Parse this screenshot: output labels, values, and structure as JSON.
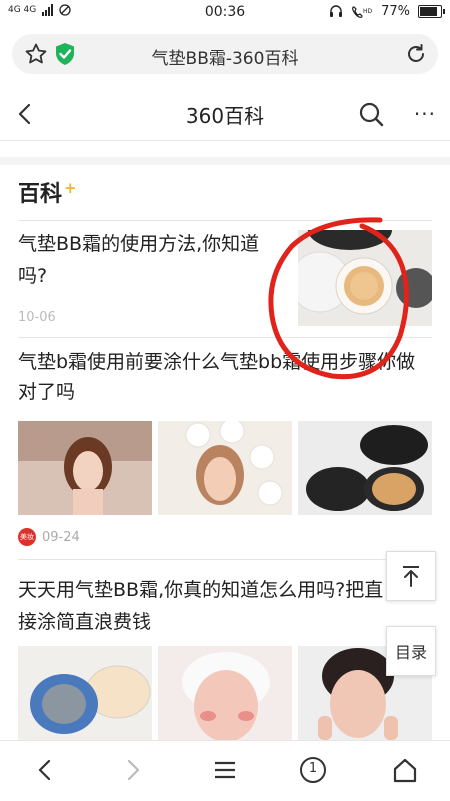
{
  "status": {
    "signal": "4G 4G",
    "time": "00:36",
    "battery": "77%",
    "battery_level": 0.77
  },
  "browser": {
    "url_title": "气垫BB霜-360百科"
  },
  "header": {
    "title": "360百科"
  },
  "section": {
    "title": "百科",
    "plus": "+"
  },
  "articles": [
    {
      "title": "气垫BB霜的使用方法,你知道吗?",
      "date": "10-06"
    },
    {
      "title": "气垫b霜使用前要涂什么气垫bb霜使用步骤你做对了吗",
      "date": "09-24",
      "source_badge": "美妆"
    },
    {
      "title": "天天用气垫BB霜,你真的知道怎么用吗?把直接涂简直浪费钱"
    }
  ],
  "floating": {
    "top_label": "↑",
    "toc_label": "目录"
  },
  "toolbar": {
    "tabs_count": "1"
  }
}
